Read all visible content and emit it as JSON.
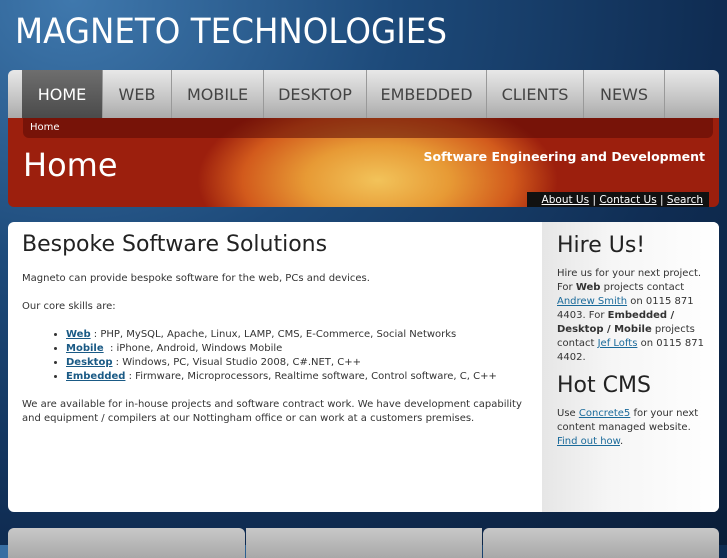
{
  "site_title": "MAGNETO TECHNOLOGIES",
  "nav": [
    "HOME",
    "WEB",
    "MOBILE",
    "DESKTOP",
    "EMBEDDED",
    "CLIENTS",
    "NEWS"
  ],
  "breadcrumb": "Home",
  "banner": {
    "title": "Home",
    "slogan": "Software Engineering and Development",
    "links": [
      "About Us",
      "Contact Us",
      "Search"
    ],
    "sep": "|"
  },
  "main": {
    "heading": "Bespoke Software Solutions",
    "intro": "Magneto can provide bespoke software for the web, PCs and devices.",
    "skills_intro": "Our core skills are:",
    "skills": [
      {
        "name": "Web",
        "desc": " : PHP, MySQL, Apache, Linux, LAMP, CMS, E-Commerce, Social Networks"
      },
      {
        "name": "Mobile",
        "desc": "  : iPhone, Android, Windows Mobile"
      },
      {
        "name": "Desktop",
        "desc": " : Windows, PC, Visual Studio 2008, C#.NET, C++"
      },
      {
        "name": "Embedded",
        "desc": " : Firmware, Microprocessors, Realtime software, Control software, C, C++"
      }
    ],
    "outro": "We are available for in-house projects and software contract work. We have development capability and equipment / compilers at our Nottingham office or can work at a customers premises."
  },
  "sidebar": {
    "hire_heading": "Hire Us!",
    "hire": [
      "Hire us for your next project. For ",
      "Web",
      " projects contact ",
      "Andrew Smith",
      " on 0115 871 4403. For ",
      "Embedded / Desktop / Mobile",
      " projects contact ",
      "Jef Lofts",
      " on 0115 871 4402."
    ],
    "cms_heading": "Hot CMS",
    "cms": [
      "Use ",
      "Concrete5",
      " for your next content managed website. ",
      "Find out how",
      "."
    ]
  }
}
